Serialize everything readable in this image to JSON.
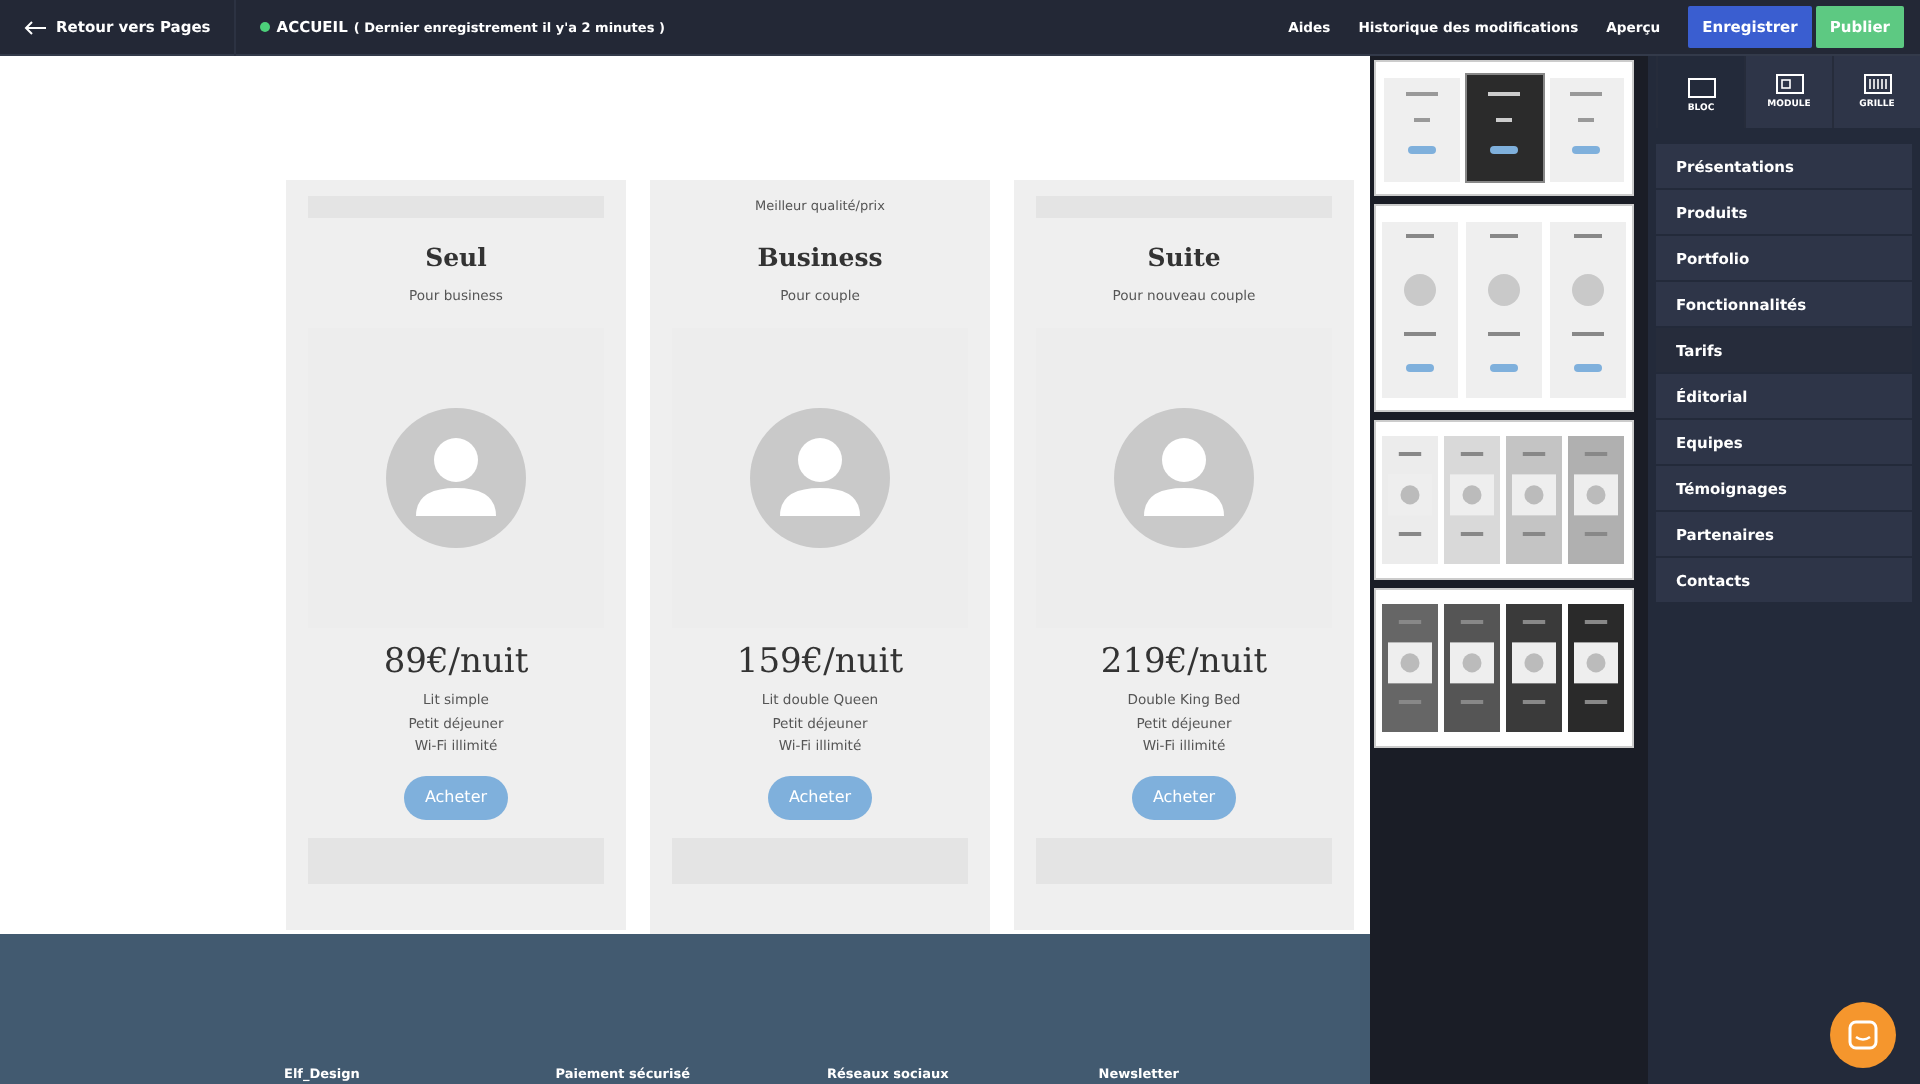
{
  "topbar": {
    "back": "Retour vers Pages",
    "page": "ACCUEIL",
    "status": "( Dernier enregistrement il y'a 2 minutes )",
    "links": [
      "Aides",
      "Historique des modifications",
      "Aperçu"
    ],
    "save": "Enregistrer",
    "publish": "Publier"
  },
  "cards": [
    {
      "title": "Seul",
      "subtitle": "Pour business",
      "price": "89€/nuit",
      "features": [
        "Lit simple",
        "Petit déjeuner",
        "Wi-Fi illimité"
      ],
      "button": "Acheter"
    },
    {
      "ribbon": "Meilleur qualité/prix",
      "title": "Business",
      "subtitle": "Pour couple",
      "price": "159€/nuit",
      "features": [
        "Lit double Queen",
        "Petit déjeuner",
        "Wi-Fi illimité"
      ],
      "button": "Acheter"
    },
    {
      "title": "Suite",
      "subtitle": "Pour nouveau couple",
      "price": "219€/nuit",
      "features": [
        "Double King Bed",
        "Petit déjeuner",
        "Wi-Fi illimité"
      ],
      "button": "Acheter"
    }
  ],
  "footer": [
    "Elf_Design",
    "Paiement sécurisé",
    "Réseaux sociaux",
    "Newsletter"
  ],
  "thumbnails": [
    {
      "kind": "dark-center"
    },
    {
      "kind": "light-avatars"
    },
    {
      "kind": "grey-four"
    },
    {
      "kind": "dark-four"
    }
  ],
  "tabs": [
    {
      "label": "BLOC",
      "selected": true
    },
    {
      "label": "MODULE",
      "selected": false
    },
    {
      "label": "GRILLE",
      "selected": false
    }
  ],
  "categories": [
    {
      "label": "Présentations",
      "selected": false
    },
    {
      "label": "Produits",
      "selected": false
    },
    {
      "label": "Portfolio",
      "selected": false
    },
    {
      "label": "Fonctionnalités",
      "selected": false
    },
    {
      "label": "Tarifs",
      "selected": true
    },
    {
      "label": "Éditorial",
      "selected": false
    },
    {
      "label": "Equipes",
      "selected": false
    },
    {
      "label": "Témoignages",
      "selected": false
    },
    {
      "label": "Partenaires",
      "selected": false
    },
    {
      "label": "Contacts",
      "selected": false
    }
  ]
}
